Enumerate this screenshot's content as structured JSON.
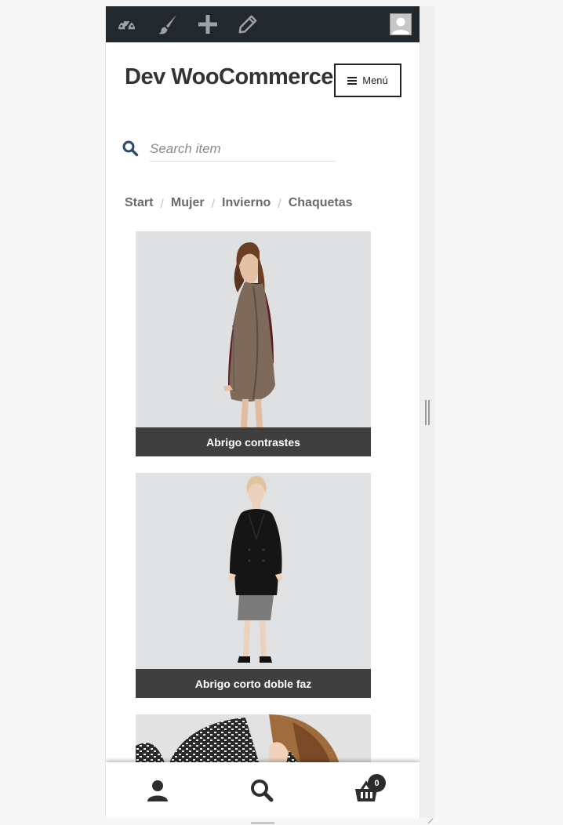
{
  "site": {
    "title": "Dev WooCommerce"
  },
  "menu": {
    "label": "Menú"
  },
  "search": {
    "placeholder": "Search item"
  },
  "breadcrumb": [
    "Start",
    "Mujer",
    "Invierno",
    "Chaquetas"
  ],
  "breadcrumb_separator": "/",
  "products": [
    {
      "title": "Abrigo contrastes"
    },
    {
      "title": "Abrigo corto doble faz"
    },
    {
      "title": ""
    }
  ],
  "admin_bar": {
    "icons": [
      "dashboard-icon",
      "customize-brush-icon",
      "new-content-plus-icon",
      "edit-pencil-icon",
      "user-avatar-icon"
    ]
  },
  "footer_bar": {
    "icons": [
      "account-icon",
      "search-icon",
      "cart-icon"
    ],
    "cart_count": "0"
  },
  "colors": {
    "admin_bar": "#23282d",
    "caption_bg": "#3f3f3f",
    "title": "#333333",
    "breadcrumb": "#6a6a6a"
  }
}
